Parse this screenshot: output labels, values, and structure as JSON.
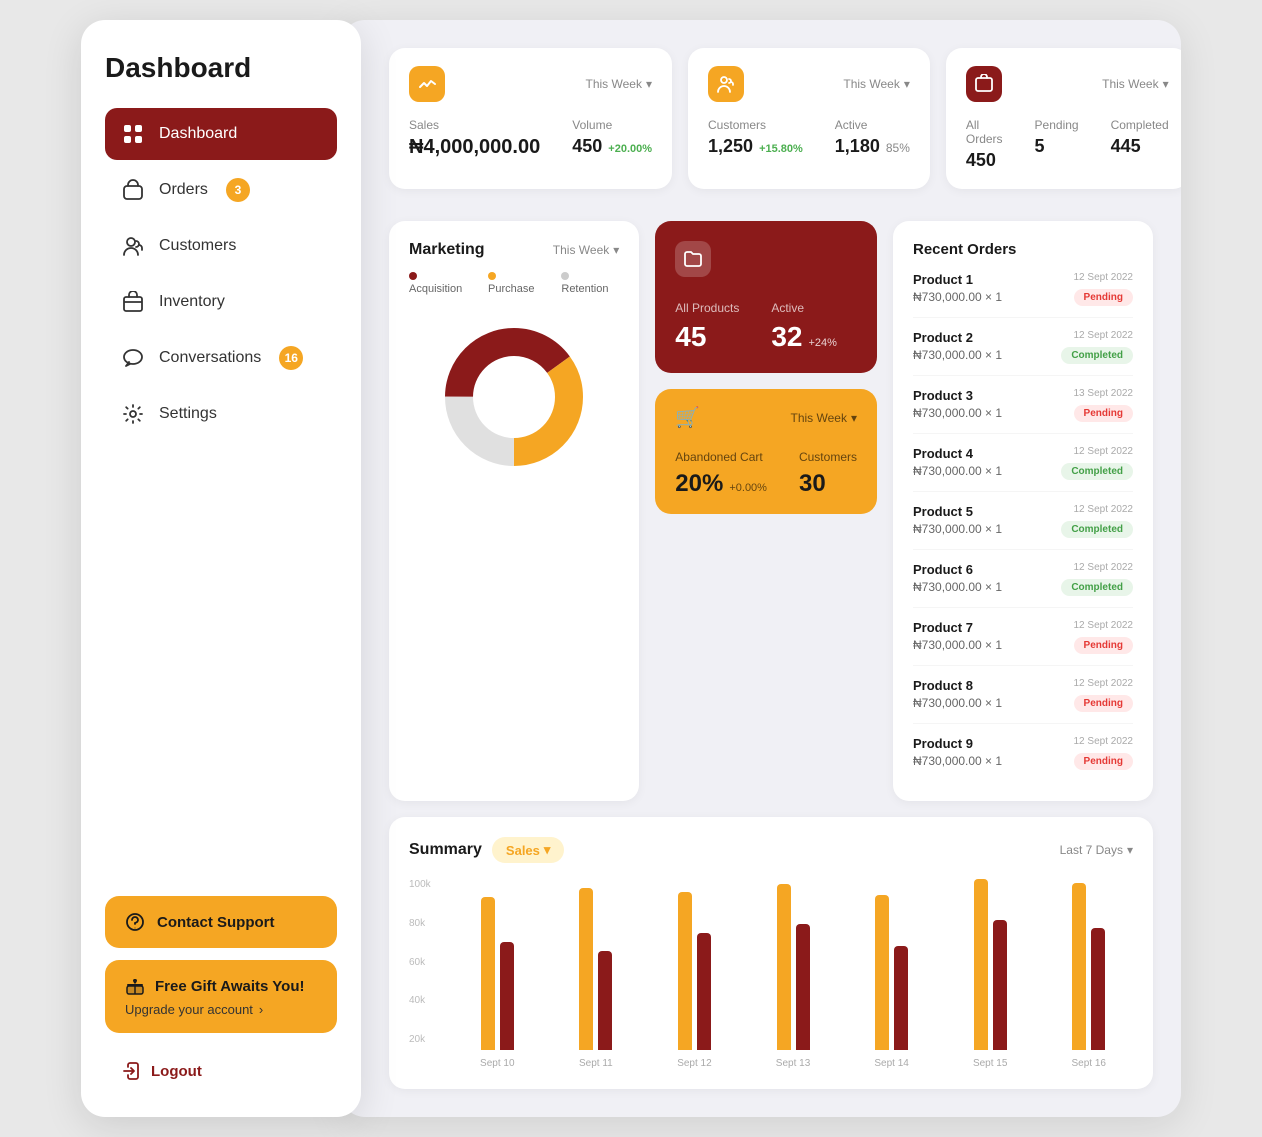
{
  "sidebar": {
    "title": "Dashboard",
    "nav_items": [
      {
        "label": "Dashboard",
        "icon": "grid",
        "active": true,
        "badge": null
      },
      {
        "label": "Orders",
        "icon": "bag",
        "active": false,
        "badge": 3
      },
      {
        "label": "Customers",
        "icon": "users",
        "active": false,
        "badge": null
      },
      {
        "label": "Inventory",
        "icon": "box",
        "active": false,
        "badge": null
      },
      {
        "label": "Conversations",
        "icon": "chat",
        "active": false,
        "badge": 16
      },
      {
        "label": "Settings",
        "icon": "gear",
        "active": false,
        "badge": null
      }
    ],
    "contact_support_label": "Contact Support",
    "gift_title": "Free Gift Awaits You!",
    "gift_subtitle": "Upgrade your account",
    "logout_label": "Logout"
  },
  "stats": {
    "sales_card": {
      "label": "This Week",
      "sales_label": "Sales",
      "sales_value": "₦4,000,000.00",
      "volume_label": "Volume",
      "volume_value": "450",
      "volume_change": "+20.00%"
    },
    "customers_card": {
      "label": "This Week",
      "customers_label": "Customers",
      "customers_value": "1,250",
      "customers_change": "+15.80%",
      "active_label": "Active",
      "active_value": "1,180",
      "active_percent": "85%"
    },
    "orders_card": {
      "label": "This Week",
      "all_orders_label": "All Orders",
      "all_orders_value": "450",
      "pending_label": "Pending",
      "pending_value": "5",
      "completed_label": "Completed",
      "completed_value": "445"
    }
  },
  "marketing": {
    "title": "Marketing",
    "period": "This Week",
    "legend": [
      {
        "label": "Acquisition",
        "color": "#8B1A1A"
      },
      {
        "label": "Purchase",
        "color": "#F5A623"
      },
      {
        "label": "Retention",
        "color": "#cccccc"
      }
    ],
    "donut": {
      "segments": [
        {
          "value": 40,
          "color": "#8B1A1A"
        },
        {
          "value": 35,
          "color": "#F5A623"
        },
        {
          "value": 25,
          "color": "#e0e0e0"
        }
      ]
    }
  },
  "products": {
    "all_products_label": "All Products",
    "all_products_value": "45",
    "active_label": "Active",
    "active_value": "32",
    "active_change": "+24%"
  },
  "abandoned_cart": {
    "period": "This Week",
    "abandoned_label": "Abandoned Cart",
    "abandoned_value": "20%",
    "abandoned_change": "+0.00%",
    "customers_label": "Customers",
    "customers_value": "30"
  },
  "recent_orders": {
    "title": "Recent Orders",
    "orders": [
      {
        "name": "Product 1",
        "amount": "₦730,000.00 × 1",
        "date": "12 Sept 2022",
        "status": "Pending"
      },
      {
        "name": "Product 2",
        "amount": "₦730,000.00 × 1",
        "date": "12 Sept 2022",
        "status": "Completed"
      },
      {
        "name": "Product 3",
        "amount": "₦730,000.00 × 1",
        "date": "13 Sept 2022",
        "status": "Pending"
      },
      {
        "name": "Product 4",
        "amount": "₦730,000.00 × 1",
        "date": "12 Sept 2022",
        "status": "Completed"
      },
      {
        "name": "Product 5",
        "amount": "₦730,000.00 × 1",
        "date": "12 Sept 2022",
        "status": "Completed"
      },
      {
        "name": "Product 6",
        "amount": "₦730,000.00 × 1",
        "date": "12 Sept 2022",
        "status": "Completed"
      },
      {
        "name": "Product 7",
        "amount": "₦730,000.00 × 1",
        "date": "12 Sept 2022",
        "status": "Pending"
      },
      {
        "name": "Product 8",
        "amount": "₦730,000.00 × 1",
        "date": "12 Sept 2022",
        "status": "Pending"
      },
      {
        "name": "Product 9",
        "amount": "₦730,000.00 × 1",
        "date": "12 Sept 2022",
        "status": "Pending"
      }
    ]
  },
  "summary": {
    "title": "Summary",
    "tab": "Sales",
    "period": "Last 7 Days",
    "x_labels": [
      "Sept 10",
      "Sept 11",
      "Sept 12",
      "Sept 13",
      "Sept 14",
      "Sept 15",
      "Sept 16"
    ],
    "y_labels": [
      "100k",
      "80k",
      "60k",
      "40k",
      "20k"
    ],
    "bars": [
      {
        "gold": 85,
        "red": 60
      },
      {
        "gold": 90,
        "red": 55
      },
      {
        "gold": 88,
        "red": 65
      },
      {
        "gold": 92,
        "red": 70
      },
      {
        "gold": 86,
        "red": 58
      },
      {
        "gold": 95,
        "red": 72
      },
      {
        "gold": 93,
        "red": 68
      }
    ]
  },
  "colors": {
    "primary_red": "#8B1A1A",
    "gold": "#F5A623",
    "white": "#ffffff",
    "light_bg": "#f0f0f5"
  }
}
